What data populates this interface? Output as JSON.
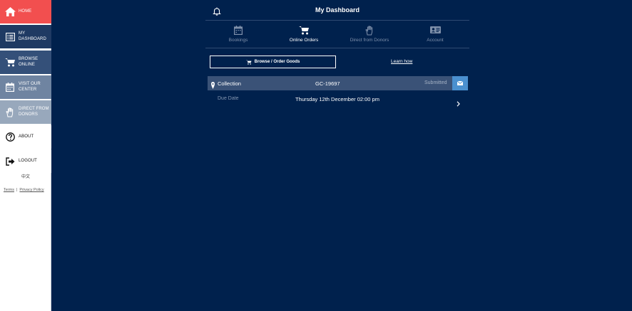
{
  "sidebar": {
    "items": [
      {
        "label": "HOME",
        "icon": "home-icon"
      },
      {
        "label": "MY DASHBOARD",
        "icon": "list-icon"
      },
      {
        "label": "BROWSE ONLINE",
        "icon": "cart-icon"
      },
      {
        "label": "VISIT OUR CENTER",
        "icon": "calendar-icon"
      },
      {
        "label": "DIRECT FROM DONORS",
        "icon": "hand-icon"
      },
      {
        "label": "ABOUT",
        "icon": "question-icon"
      },
      {
        "label": "LOGOUT",
        "icon": "logout-icon"
      }
    ],
    "language": "中文",
    "terms": "Terms",
    "separator": "|",
    "privacy": "Privacy Policy"
  },
  "header": {
    "title": "My Dashboard",
    "bell_icon": "bell-icon"
  },
  "tabs": [
    {
      "label": "Bookings",
      "icon": "calendar-icon",
      "active": false
    },
    {
      "label": "Online Orders",
      "icon": "cart-icon",
      "active": true
    },
    {
      "label": "Direct from Donors",
      "icon": "hand-icon",
      "active": false
    },
    {
      "label": "Account",
      "icon": "id-card-icon",
      "active": false
    }
  ],
  "actions": {
    "browse_label": "Browse / Order Goods",
    "learn_label": "Learn how"
  },
  "order": {
    "type": "Collection",
    "code": "GC-19697",
    "status": "Submitted",
    "due_label": "Due Date",
    "due_value": "Thursday 12th December 02:00 pm"
  },
  "colors": {
    "background": "#00214d",
    "home_active": "#f24f4f",
    "order_row": "#3a5277",
    "message_button": "#4a90cf"
  }
}
